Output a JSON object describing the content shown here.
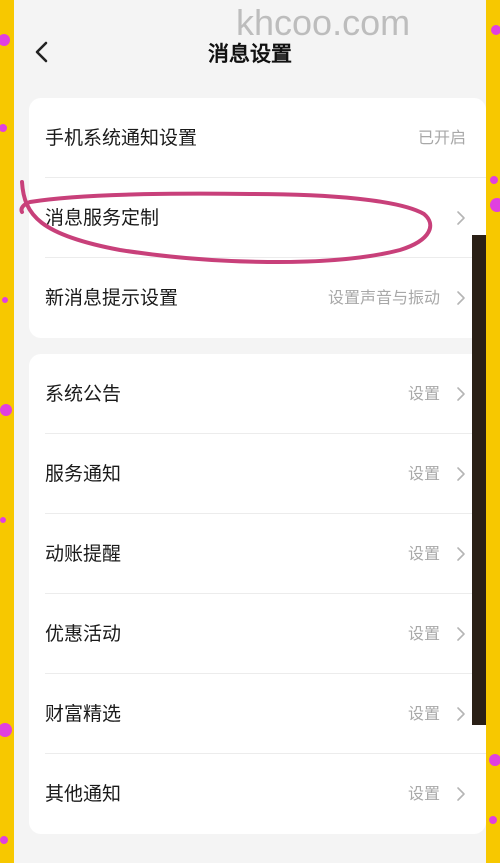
{
  "header": {
    "title": "消息设置"
  },
  "watermark": "khcoo.com",
  "group1": [
    {
      "label": "手机系统通知设置",
      "value": "已开启",
      "arrow": false
    },
    {
      "label": "消息服务定制",
      "value": "",
      "arrow": true
    },
    {
      "label": "新消息提示设置",
      "value": "设置声音与振动",
      "arrow": true
    }
  ],
  "group2": [
    {
      "label": "系统公告",
      "value": "设置"
    },
    {
      "label": "服务通知",
      "value": "设置"
    },
    {
      "label": "动账提醒",
      "value": "设置"
    },
    {
      "label": "优惠活动",
      "value": "设置"
    },
    {
      "label": "财富精选",
      "value": "设置"
    },
    {
      "label": "其他通知",
      "value": "设置"
    }
  ],
  "colors": {
    "background": "#f7c800",
    "dots": "#e040e0",
    "annotation": "#c8407a"
  },
  "icons": {
    "back": "chevron-left-icon",
    "row_arrow": "chevron-right-icon"
  }
}
